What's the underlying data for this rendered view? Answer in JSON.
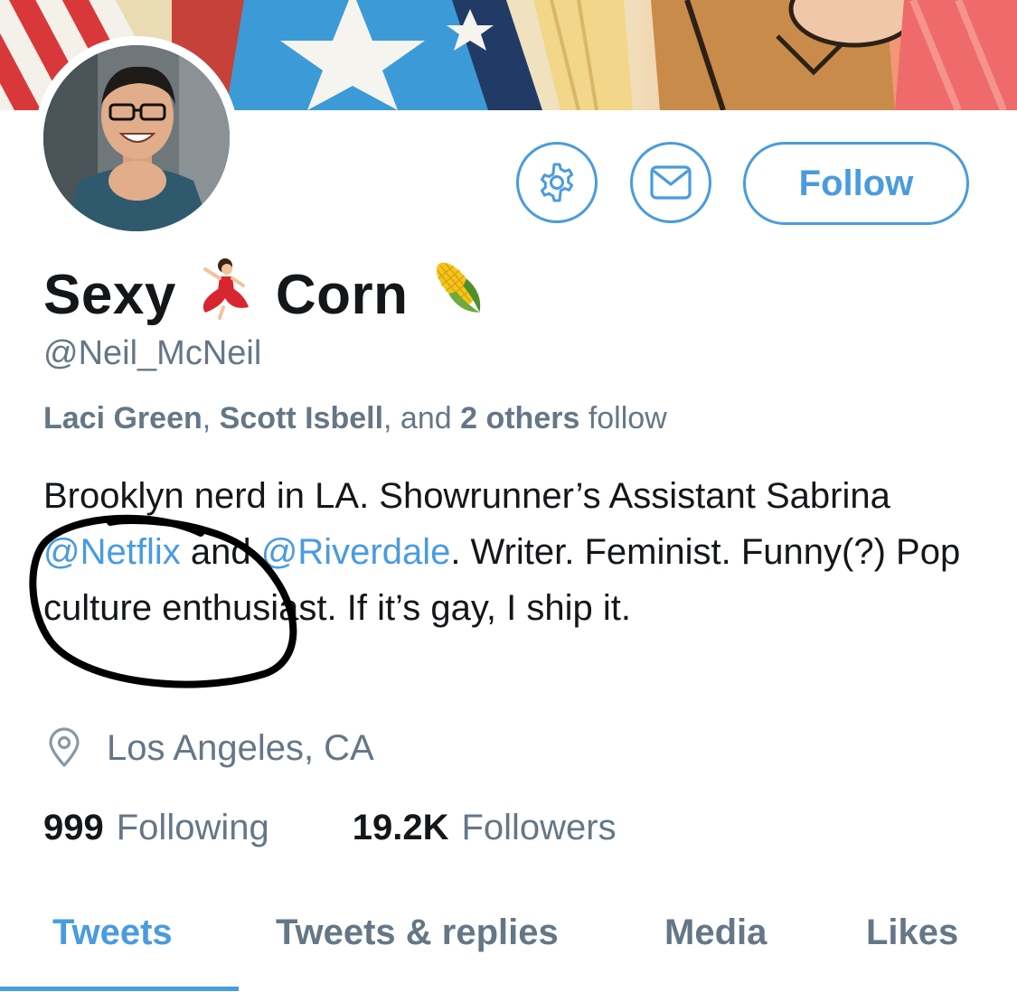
{
  "profile": {
    "display_name_part1": "Sexy",
    "display_name_part2": "Corn",
    "emoji_dancer": "💃",
    "emoji_corn": "🌽",
    "handle": "@Neil_McNeil"
  },
  "actions": {
    "settings_icon": "gear-icon",
    "message_icon": "envelope-icon",
    "follow_label": "Follow"
  },
  "followed_by": {
    "name1": "Laci Green",
    "sep1": ",",
    "name2": "Scott Isbell",
    "sep2": ", and",
    "others": "2 others",
    "suffix": "follow"
  },
  "bio": {
    "part1": "Brooklyn nerd in LA. Showrunner’s Assistant Sabrina",
    "mention1": "@Netflix",
    "part2": "and",
    "mention2": "@Riverdale",
    "part3": ". Writer. Feminist. Funny(?) Pop culture enthusiast. If it’s gay, I ship it."
  },
  "location": {
    "icon": "location-pin-icon",
    "text": "Los Angeles, CA"
  },
  "stats": {
    "following_count": "999",
    "following_label": "Following",
    "followers_count": "19.2K",
    "followers_label": "Followers"
  },
  "tabs": [
    {
      "label": "Tweets",
      "active": true
    },
    {
      "label": "Tweets & replies",
      "active": false
    },
    {
      "label": "Media",
      "active": false
    },
    {
      "label": "Likes",
      "active": false
    }
  ],
  "colors": {
    "accent": "#4a9bdf",
    "secondary_text": "#657786",
    "primary_text": "#14171a",
    "annotation": "#000000"
  }
}
